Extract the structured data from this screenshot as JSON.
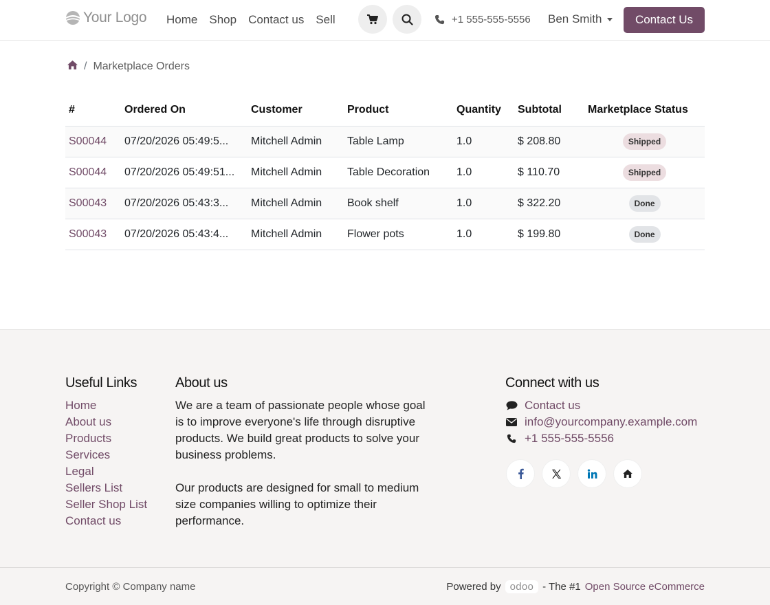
{
  "brand": {
    "logo_text": "Your Logo",
    "accent": "#714b67"
  },
  "nav": {
    "items": [
      "Home",
      "Shop",
      "Contact us",
      "Sell"
    ],
    "phone": "+1 555-555-5556",
    "user": "Ben Smith",
    "cta": "Contact Us"
  },
  "breadcrumb": {
    "current": "Marketplace Orders"
  },
  "table": {
    "headers": [
      "#",
      "Ordered On",
      "Customer",
      "Product",
      "Quantity",
      "Subtotal",
      "Marketplace Status"
    ],
    "rows": [
      {
        "ref": "S00044",
        "ordered_on": "07/20/2026 05:49:5...",
        "customer": "Mitchell Admin",
        "product": "Table Lamp",
        "qty": "1.0",
        "subtotal": "$ 208.80",
        "status": "Shipped"
      },
      {
        "ref": "S00044",
        "ordered_on": "07/20/2026 05:49:51...",
        "customer": "Mitchell Admin",
        "product": "Table Decoration",
        "qty": "1.0",
        "subtotal": "$ 110.70",
        "status": "Shipped"
      },
      {
        "ref": "S00043",
        "ordered_on": "07/20/2026 05:43:3...",
        "customer": "Mitchell Admin",
        "product": "Book shelf",
        "qty": "1.0",
        "subtotal": "$ 322.20",
        "status": "Done"
      },
      {
        "ref": "S00043",
        "ordered_on": "07/20/2026 05:43:4...",
        "customer": "Mitchell Admin",
        "product": "Flower pots",
        "qty": "1.0",
        "subtotal": "$ 199.80",
        "status": "Done"
      }
    ]
  },
  "footer": {
    "links_title": "Useful Links",
    "links": [
      "Home",
      "About us",
      "Products",
      "Services",
      "Legal",
      "Sellers List",
      "Seller Shop List",
      "Contact us"
    ],
    "about_title": "About us",
    "about_p1": "We are a team of passionate people whose goal is to improve everyone's life through disruptive products. We build great products to solve your business problems.",
    "about_p2": "Our products are designed for small to medium size companies willing to optimize their performance.",
    "connect_title": "Connect with us",
    "contact_link": "Contact us",
    "email": "info@yourcompany.example.com",
    "phone": "+1 555-555-5556",
    "socials": [
      "facebook-icon",
      "x-icon",
      "linkedin-icon",
      "home-icon"
    ]
  },
  "copyright": {
    "text": "Copyright © Company name",
    "powered_by": "Powered by",
    "odoo": "odoo",
    "dash": "- The #1",
    "link": "Open Source eCommerce"
  }
}
